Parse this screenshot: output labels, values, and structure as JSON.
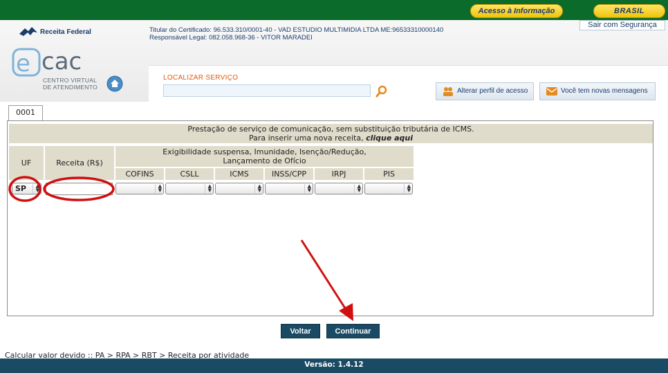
{
  "gov_bar": {
    "acesso_label": "Acesso à Informação",
    "brasil_label": "BRASIL"
  },
  "header": {
    "agency": "Receita Federal",
    "certificate_line": "Titular do Certificado: 96.533.310/0001-40 - VAD ESTUDIO MULTIMIDIA LTDA ME:96533310000140",
    "responsible_line": "Responsável Legal: 082.058.968-36 - VITOR MARADEI",
    "logout_label": "Sair com Segurança",
    "logo_text": "cac",
    "logo_sub_1": "CENTRO VIRTUAL",
    "logo_sub_2": "DE ATENDIMENTO",
    "search_title": "LOCALIZAR SERVIÇO",
    "search_value": "",
    "profile_button": "Alterar perfil de acesso",
    "messages_button": "Você tem novas mensagens"
  },
  "tab": {
    "label": "0001"
  },
  "info": {
    "line1": "Prestação de serviço de comunicação, sem substituição tributária de ICMS.",
    "line2_prefix": "Para inserir uma nova receita, ",
    "line2_link": "clique aqui"
  },
  "table": {
    "col_uf": "UF",
    "col_receita": "Receita (R$)",
    "group_header_1": "Exigibilidade suspensa, Imunidade, Isenção/Redução,",
    "group_header_2": "Lançamento de Ofício",
    "sub_headers": [
      "COFINS",
      "CSLL",
      "ICMS",
      "INSS/CPP",
      "IRPJ",
      "PIS"
    ],
    "uf_value": "SP",
    "receita_value": ""
  },
  "buttons": {
    "back": "Voltar",
    "continue": "Continuar"
  },
  "breadcrumb": "Calcular valor devido :: PA > RPA > RBT > Receita por atividade",
  "footer": "Versão: 1.4.12",
  "colors": {
    "gov_green": "#0a6b2b",
    "brand_navy": "#1a4a64",
    "table_header_bg": "#dfdccb",
    "annotation_red": "#d01010"
  }
}
